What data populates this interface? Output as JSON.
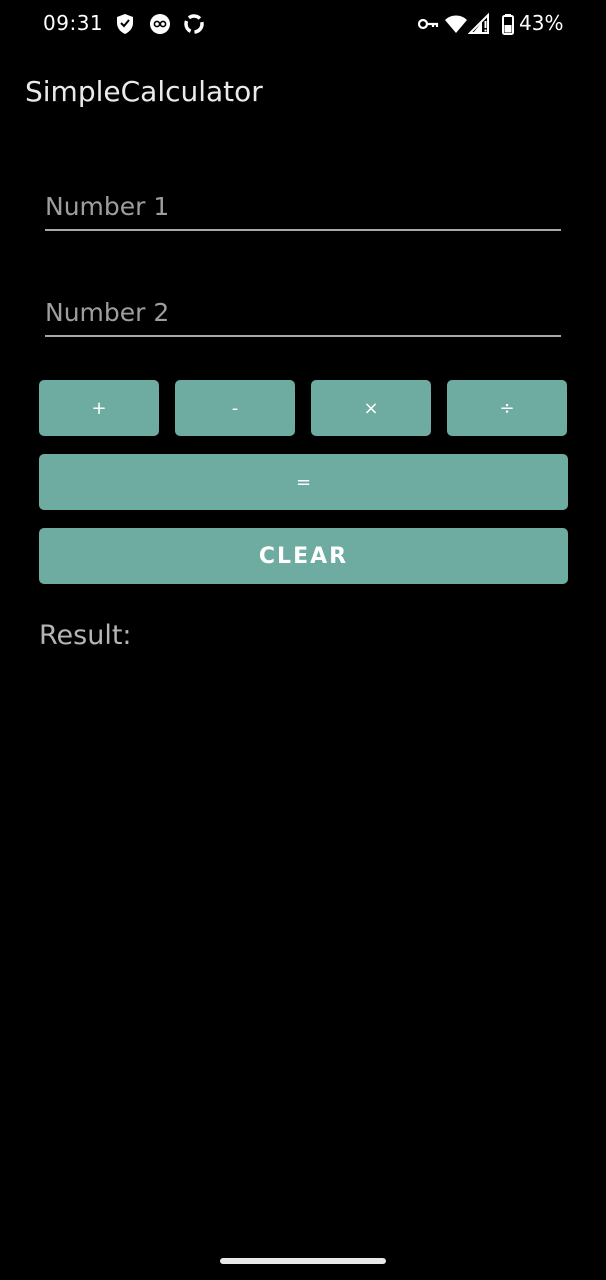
{
  "status_bar": {
    "time": "09:31",
    "battery": "43%",
    "left_icons": [
      "shield-icon",
      "notification-icon",
      "sync-icon"
    ],
    "right_icons": [
      "vpn-key-icon",
      "wifi-icon",
      "signal-icon",
      "battery-icon"
    ]
  },
  "app": {
    "title": "SimpleCalculator"
  },
  "inputs": {
    "number1": {
      "placeholder": "Number 1",
      "value": ""
    },
    "number2": {
      "placeholder": "Number 2",
      "value": ""
    }
  },
  "buttons": {
    "add": "+",
    "subtract": "-",
    "multiply": "×",
    "divide": "÷",
    "equals": "=",
    "clear": "CLEAR"
  },
  "result": {
    "label": "Result:"
  },
  "colors": {
    "background": "#000000",
    "button": "#6eaba0",
    "underline": "#a8a8a8",
    "placeholder": "#9e9e9e"
  }
}
